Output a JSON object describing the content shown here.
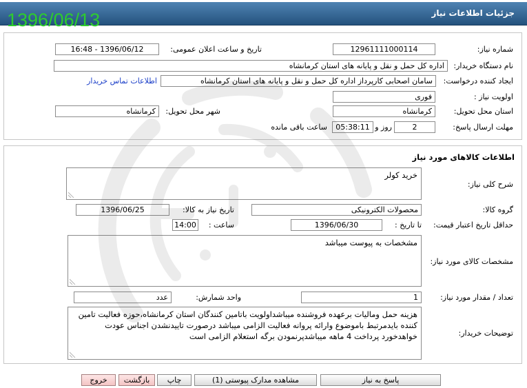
{
  "overlay_date": "1396/06/13",
  "header": {
    "title": "جزئیات اطلاعات نیاز"
  },
  "need_info": {
    "need_number": {
      "label": "شماره نیاز:",
      "value": "12961111000114"
    },
    "announce_datetime": {
      "label": "تاریخ و ساعت اعلان عمومی:",
      "value": "1396/06/12 - 16:48"
    },
    "buyer_org": {
      "label": "نام دستگاه خریدار:",
      "value": "اداره کل حمل و نقل و پایانه های استان کرمانشاه"
    },
    "requester": {
      "label": "ایجاد کننده درخواست:",
      "value": "سامان  اصحابی کارپرداز اداره کل حمل و نقل و پایانه های استان کرمانشاه",
      "contact_link": "اطلاعات تماس خریدار"
    },
    "priority": {
      "label": "اولویت نیاز :",
      "value": "فوری"
    },
    "delivery_province": {
      "label": "استان محل تحویل:",
      "value": "کرمانشاه"
    },
    "delivery_city": {
      "label": "شهر محل تحویل:",
      "value": "کرمانشاه"
    },
    "deadline": {
      "label": "مهلت ارسال پاسخ:",
      "days": "2",
      "days_suffix": "روز و",
      "time": "05:38:11",
      "time_suffix": "ساعت باقی مانده"
    }
  },
  "goods_info": {
    "title": "اطلاعات کالاهای مورد نیاز",
    "description": {
      "label": "شرح کلی نیاز:",
      "value": "خرید کولر"
    },
    "goods_group": {
      "label": "گروه کالا:",
      "value": "محصولات الکترونیکی"
    },
    "need_date": {
      "label": "تاریخ نیاز به کالا:",
      "value": "1396/06/25"
    },
    "price_validity": {
      "label": "حداقل تاریخ اعتبار قیمت:",
      "to_date_label": "تا تاریخ :",
      "to_date": "1396/06/30",
      "hour_label": "ساعت :",
      "hour": "14:00"
    },
    "specs": {
      "label": "مشخصات کالای مورد نیاز:",
      "value": "مشخصات به پیوست میباشد"
    },
    "quantity": {
      "label": "تعداد / مقدار مورد نیاز:",
      "value": "1"
    },
    "unit": {
      "label": "واحد شمارش:",
      "value": "عدد"
    },
    "buyer_notes": {
      "label": "توضیحات خریدار:",
      "value": "هزینه حمل ومالیات برعهده فروشنده میباشداولویت باتامین کنندگان استان کرمانشاه،حوزه فعالیت تامین کننده بایدمرتبط باموضوع وارائه پروانه فعالیت الزامی میباشد درصورت تاییدنشدن اجناس عودت خواهدخورد پرداخت 4 ماهه میباشدپرنمودن برگه استعلام الزامی است"
    }
  },
  "actions": {
    "reply": "پاسخ به نیاز",
    "attachments": "مشاهده مدارک پیوستی (1)",
    "print": "چاپ",
    "back": "بازگشت",
    "exit": "خروج"
  },
  "colors": {
    "header_bar": "#24527d",
    "overlay_date": "#2ecc2e",
    "link": "#1a3ec8",
    "danger_button": "#f4c4c4"
  }
}
